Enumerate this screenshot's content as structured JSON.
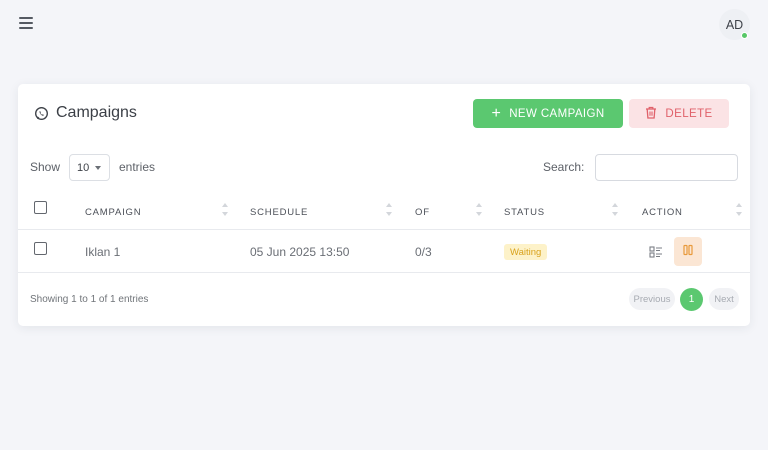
{
  "header": {
    "menu_icon": "hamburger-icon",
    "avatar_initials": "AD",
    "online_status_color": "#57c767"
  },
  "card": {
    "title": "Campaigns",
    "title_icon": "whatsapp-icon",
    "new_button_label": "NEW CAMPAIGN",
    "delete_button_label": "DELETE",
    "accent_color": "#5bc870",
    "danger_color": "#e0616a"
  },
  "controls": {
    "show_label": "Show",
    "page_length": "10",
    "entries_label": "entries",
    "search_label": "Search:",
    "search_value": ""
  },
  "table": {
    "columns": [
      "CAMPAIGN",
      "SCHEDULE",
      "OF",
      "STATUS",
      "ACTION"
    ],
    "rows": [
      {
        "campaign": "Iklan 1",
        "schedule": "05 Jun 2025 13:50",
        "of": "0/3",
        "status": "Waiting",
        "actions": [
          "detail-list-icon",
          "pause-icon"
        ]
      }
    ]
  },
  "footer": {
    "info": "Showing 1 to 1 of 1 entries",
    "previous_label": "Previous",
    "current_page": "1",
    "next_label": "Next"
  }
}
